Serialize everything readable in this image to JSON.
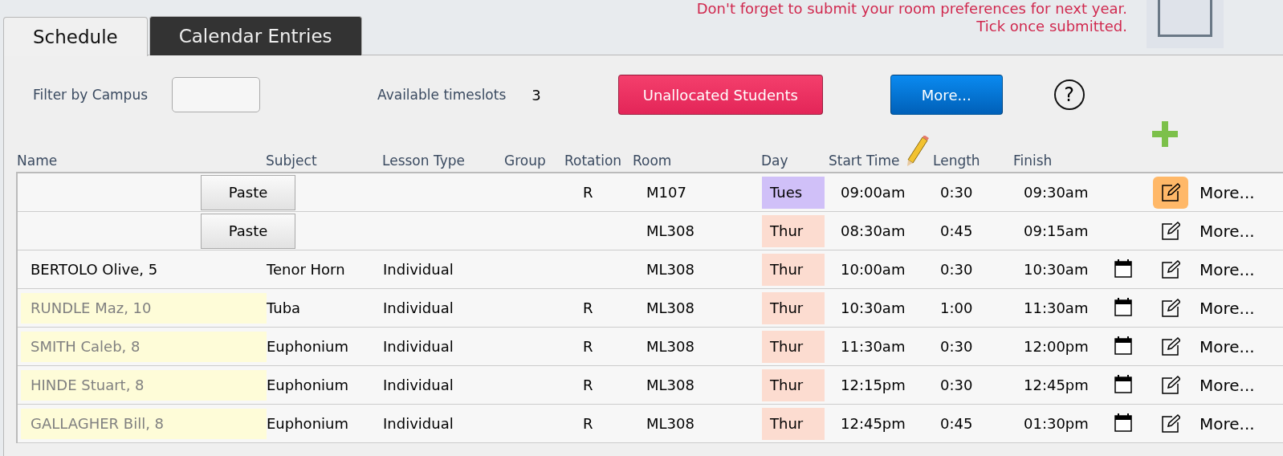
{
  "notice": {
    "text": "Don't forget to submit your room preferences for next year. Tick once submitted.",
    "checked": false
  },
  "tabs": [
    {
      "label": "Schedule",
      "selected": true
    },
    {
      "label": "Calendar Entries",
      "selected": false
    }
  ],
  "toolbar": {
    "filter_label": "Filter by Campus",
    "timeslots_label": "Available timeslots",
    "timeslots_count": "3",
    "unallocated_button": "Unallocated Students",
    "more_button": "More...",
    "help_label": "?"
  },
  "table": {
    "columns": [
      "Name",
      "Subject",
      "Lesson Type",
      "Group",
      "Rotation",
      "Room",
      "Day",
      "Start Time",
      "Length",
      "Finish"
    ],
    "rows": [
      {
        "kind": "paste",
        "paste_button": "Paste",
        "rotation": "R",
        "room": "M107",
        "day": "Tues",
        "color": "#d0c0f8",
        "start": "09:00am",
        "length": "0:30",
        "finish": "09:30am",
        "highlighted": false,
        "has_calendar": false,
        "edit_active": true,
        "more": "More..."
      },
      {
        "kind": "paste",
        "paste_button": "Paste",
        "room": "ML308",
        "day": "Thur",
        "color": "#fcdcd0",
        "start": "08:30am",
        "length": "0:45",
        "finish": "09:15am",
        "highlighted": false,
        "has_calendar": false,
        "edit_active": false,
        "more": "More..."
      },
      {
        "kind": "student",
        "name": "BERTOLO Olive, 5",
        "subject": "Tenor Horn",
        "lesson_type": "Individual",
        "room": "ML308",
        "day": "Thur",
        "color": "#fcdcd0",
        "start": "10:00am",
        "length": "0:30",
        "finish": "10:30am",
        "highlighted": false,
        "has_calendar": true,
        "edit_active": false,
        "more": "More..."
      },
      {
        "kind": "student",
        "name": "RUNDLE Maz, 10",
        "subject": "Tuba",
        "lesson_type": "Individual",
        "rotation": "R",
        "room": "ML308",
        "day": "Thur",
        "color": "#fcdcd0",
        "start": "10:30am",
        "length": "1:00",
        "finish": "11:30am",
        "highlighted": true,
        "has_calendar": true,
        "edit_active": false,
        "more": "More..."
      },
      {
        "kind": "student",
        "name": "SMITH Caleb, 8",
        "subject": "Euphonium",
        "lesson_type": "Individual",
        "rotation": "R",
        "room": "ML308",
        "day": "Thur",
        "color": "#fcdcd0",
        "start": "11:30am",
        "length": "0:30",
        "finish": "12:00pm",
        "highlighted": true,
        "has_calendar": true,
        "edit_active": false,
        "more": "More..."
      },
      {
        "kind": "student",
        "name": "HINDE Stuart, 8",
        "subject": "Euphonium",
        "lesson_type": "Individual",
        "rotation": "R",
        "room": "ML308",
        "day": "Thur",
        "color": "#fcdcd0",
        "start": "12:15pm",
        "length": "0:30",
        "finish": "12:45pm",
        "highlighted": true,
        "has_calendar": true,
        "edit_active": false,
        "more": "More..."
      },
      {
        "kind": "student",
        "name": "GALLAGHER Bill, 8",
        "subject": "Euphonium",
        "lesson_type": "Individual",
        "rotation": "R",
        "room": "ML308",
        "day": "Thur",
        "color": "#fcdcd0",
        "start": "12:45pm",
        "length": "0:45",
        "finish": "01:30pm",
        "highlighted": true,
        "has_calendar": true,
        "edit_active": false,
        "more": "More..."
      }
    ]
  }
}
